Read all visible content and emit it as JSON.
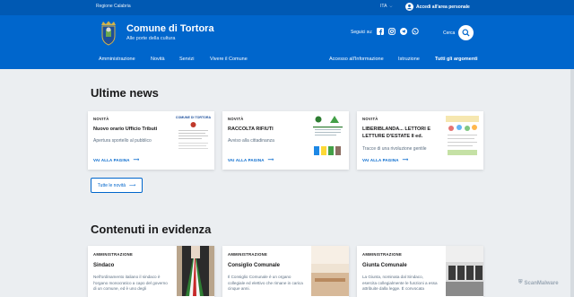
{
  "slim_header": {
    "region": "Regione Calabria",
    "language": "ITA",
    "login": "Accedi all'area personale"
  },
  "header": {
    "title": "Comune di Tortora",
    "subtitle": "Alle porte della cultura",
    "follow_label": "Seguici su:",
    "social_icons": [
      "facebook-icon",
      "instagram-icon",
      "telegram-icon",
      "whatsapp-icon"
    ],
    "search_label": "Cerca"
  },
  "nav": {
    "items": [
      "Amministrazione",
      "Novità",
      "Servizi",
      "Vivere il Comune"
    ],
    "secondary": [
      "Accesso all'Informazione",
      "Istruzione",
      "Tutti gli argomenti"
    ]
  },
  "news": {
    "heading": "Ultime news",
    "cards": [
      {
        "category": "NOVITÀ",
        "title": "Nuovo orario Ufficio Tributi",
        "description": "Apertura sportello al pubblico",
        "link": "VAI ALLA PAGINA",
        "thumb_heading": "COMUNE DI TORTORA"
      },
      {
        "category": "NOVITÀ",
        "title": "RACCOLTA RIFIUTI",
        "description": "Avviso alla cittadinanza",
        "link": "VAI ALLA PAGINA"
      },
      {
        "category": "NOVITÀ",
        "title": "LIBERIBLANDA... LETTORI E LETTURE D'ESTATE II ed.",
        "description": "Tracce di una rivoluzione gentile",
        "link": "VAI ALLA PAGINA"
      }
    ],
    "all_button": "Tutte le novità"
  },
  "evidence": {
    "heading": "Contenuti in evidenza",
    "cards": [
      {
        "category": "AMMINISTRAZIONE",
        "title": "Sindaco",
        "description": "Nell'ordinamento italiano il sindaco è l'organo monocratico a capo del governo di un comune, ed è uno degli"
      },
      {
        "category": "AMMINISTRAZIONE",
        "title": "Consiglio Comunale",
        "description": "Il Consiglio Comunale è un organo collegiale ed elettivo che rimane in carica cinque anni."
      },
      {
        "category": "AMMINISTRAZIONE",
        "title": "Giunta Comunale",
        "description": "La Giunta, nominata dal Sindaco, esercita collegialmente le funzioni a essa attribuite dalla legge. È convocata"
      }
    ]
  },
  "watermark": "ScanMalware",
  "colors": {
    "primary": "#0066cc",
    "dark_primary": "#0059b3",
    "background": "#ebeef1"
  }
}
